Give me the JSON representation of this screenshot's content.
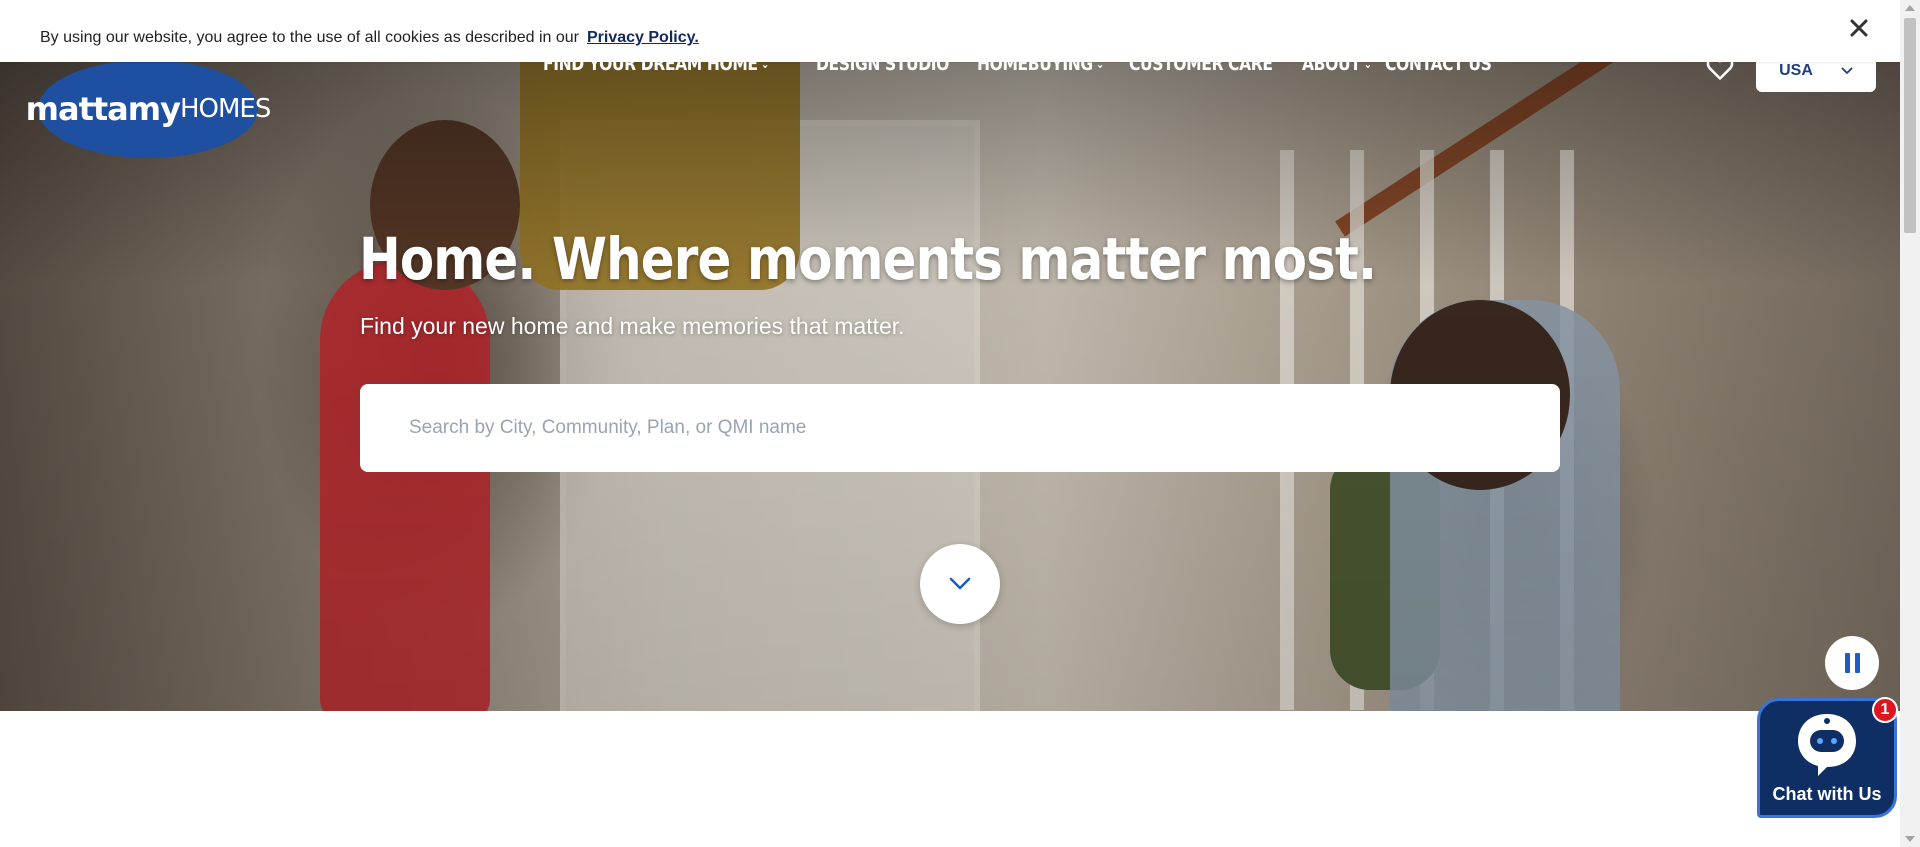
{
  "cookie_banner": {
    "text": "By using our website, you agree to the use of all cookies as described in our",
    "link": "Privacy Policy.",
    "close_icon": "close-icon"
  },
  "logo": {
    "bold": "mattamy",
    "light": "HOMES"
  },
  "nav": {
    "items": [
      {
        "label": "FIND YOUR DREAM HOME",
        "has_dropdown": true
      },
      {
        "label": "DESIGN STUDIO",
        "has_dropdown": false
      },
      {
        "label": "HOMEBUYING",
        "has_dropdown": true
      },
      {
        "label": "CUSTOMER CARE",
        "has_dropdown": false
      },
      {
        "label": "ABOUT",
        "has_dropdown": true
      },
      {
        "label": "CONTACT US",
        "has_dropdown": false
      }
    ],
    "favorites_icon": "heart-icon",
    "country": {
      "selected": "USA"
    }
  },
  "hero": {
    "headline": "Home. Where moments matter most.",
    "subhead": "Find your new home and make memories that matter.",
    "search": {
      "placeholder": "Search by City, Community, Plan, or QMI name",
      "value": ""
    },
    "scroll_icon": "chevron-down-icon",
    "pause_icon": "pause-icon"
  },
  "chat": {
    "label": "Chat with Us",
    "badge_count": "1",
    "icon": "chatbot-icon"
  },
  "colors": {
    "brand_blue": "#1e4fa0",
    "navy": "#0f2f64",
    "link_navy": "#10295e",
    "accent_blue": "#1d5cc4",
    "badge_red": "#e0141e"
  }
}
